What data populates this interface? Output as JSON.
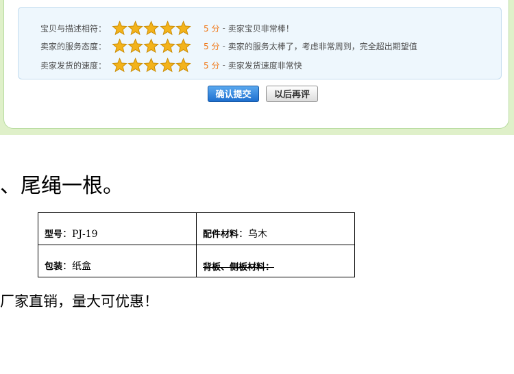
{
  "rating": {
    "rows": [
      {
        "label": "宝贝与描述相符：",
        "stars": 5,
        "score": "5 分",
        "dash": "-",
        "desc": "卖家宝贝非常棒！"
      },
      {
        "label": "卖家的服务态度：",
        "stars": 5,
        "score": "5 分",
        "dash": "-",
        "desc": "卖家的服务太棒了，考虑非常周到，完全超出期望值"
      },
      {
        "label": "卖家发货的速度：",
        "stars": 5,
        "score": "5 分",
        "dash": "-",
        "desc": "卖家发货速度非常快"
      }
    ],
    "star_color": "#f3b31b",
    "confirm_label": "确认提交",
    "later_label": "以后再评"
  },
  "heading": "、尾绳一根。",
  "spec": {
    "model_key": "型号",
    "model_sep": "：",
    "model_value": "PJ-19",
    "material_key": "配件材料",
    "material_sep": "：",
    "material_value": "乌木",
    "package_key": "包装",
    "package_sep": "：",
    "package_value": "纸盒",
    "board_text": "背板、侧板材料：",
    "board_value": ""
  },
  "promo": "厂家直销，量大可优惠！"
}
